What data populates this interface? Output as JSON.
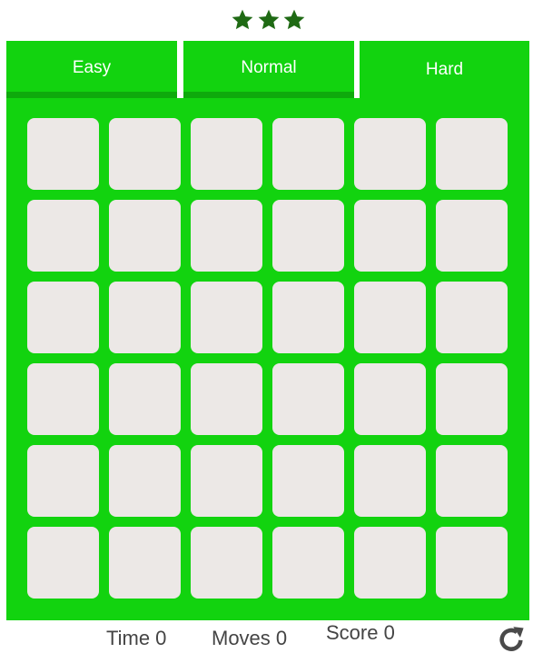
{
  "rating": {
    "stars": 3,
    "star_color": "#1f6a14"
  },
  "difficulty_tabs": [
    {
      "label": "Easy"
    },
    {
      "label": "Normal"
    },
    {
      "label": "Hard"
    }
  ],
  "board": {
    "rows": 6,
    "columns": 6,
    "board_color": "#12d30f",
    "card_back_color": "#ece8e6"
  },
  "stats": {
    "time": "Time 0",
    "moves": "Moves 0",
    "score": "Score 0"
  },
  "restart": {
    "icon": "restart-icon"
  }
}
